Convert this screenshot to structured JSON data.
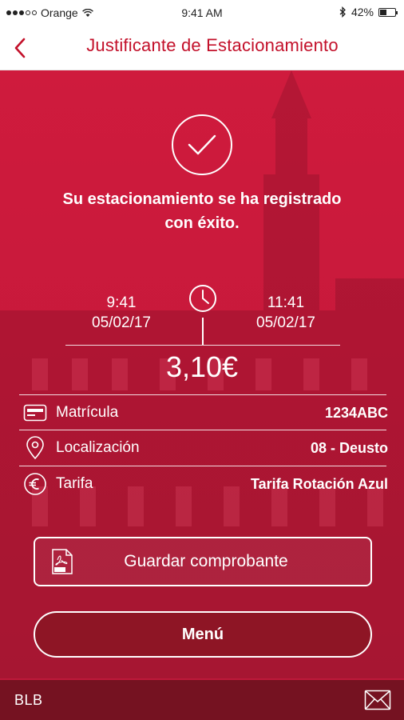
{
  "status_bar": {
    "carrier": "Orange",
    "time": "9:41 AM",
    "battery": "42%",
    "battery_level": 0.42
  },
  "nav": {
    "title": "Justificante de Estacionamiento",
    "back_icon": "chevron-left-icon"
  },
  "receipt": {
    "success_line1": "Su estacionamiento se ha registrado",
    "success_line2": "con éxito.",
    "start_time": "9:41",
    "start_date": "05/02/17",
    "end_time": "11:41",
    "end_date": "05/02/17",
    "price": "3,10€",
    "details": [
      {
        "icon": "license-plate-icon",
        "label": "Matrícula",
        "value": "1234ABC"
      },
      {
        "icon": "location-pin-icon",
        "label": "Localización",
        "value": "08 - Deusto"
      },
      {
        "icon": "euro-icon",
        "label": "Tarifa",
        "value": "Tarifa Rotación Azul"
      }
    ]
  },
  "actions": {
    "save_label": "Guardar comprobante",
    "menu_label": "Menú"
  },
  "footer": {
    "brand": "BLB"
  },
  "colors": {
    "accent": "#c3102a",
    "hero": "#c8193b",
    "footer": "#751221",
    "menu_button": "#8e1525"
  }
}
